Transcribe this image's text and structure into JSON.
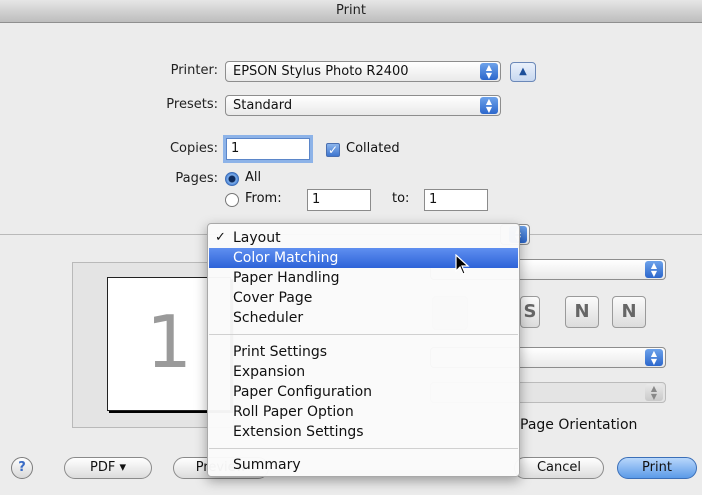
{
  "window": {
    "title": "Print"
  },
  "printer": {
    "label": "Printer:",
    "value": "EPSON Stylus Photo R2400"
  },
  "presets": {
    "label": "Presets:",
    "value": "Standard"
  },
  "copies": {
    "label": "Copies:",
    "value": "1",
    "collated_label": "Collated",
    "collated_checked": true
  },
  "pages": {
    "label": "Pages:",
    "all_label": "All",
    "from_label": "From:",
    "from_value": "1",
    "to_label": "to:",
    "to_value": "1",
    "selected": "All"
  },
  "preview": {
    "page_number": "1"
  },
  "menu": {
    "sections": [
      [
        "Layout",
        "Color Matching",
        "Paper Handling",
        "Cover Page",
        "Scheduler"
      ],
      [
        "Print Settings",
        "Expansion",
        "Paper Configuration",
        "Roll Paper Option",
        "Extension Settings"
      ],
      [
        "Summary"
      ]
    ],
    "checked": "Layout",
    "highlighted": "Color Matching"
  },
  "background_text": {
    "page_orientation": "Page Orientation"
  },
  "buttons": {
    "help": "?",
    "pdf": "PDF ▾",
    "preview": "Preview",
    "cancel": "Cancel",
    "print": "Print"
  },
  "colors": {
    "highlight": "#2d63d8",
    "accent": "#3b74cf"
  }
}
